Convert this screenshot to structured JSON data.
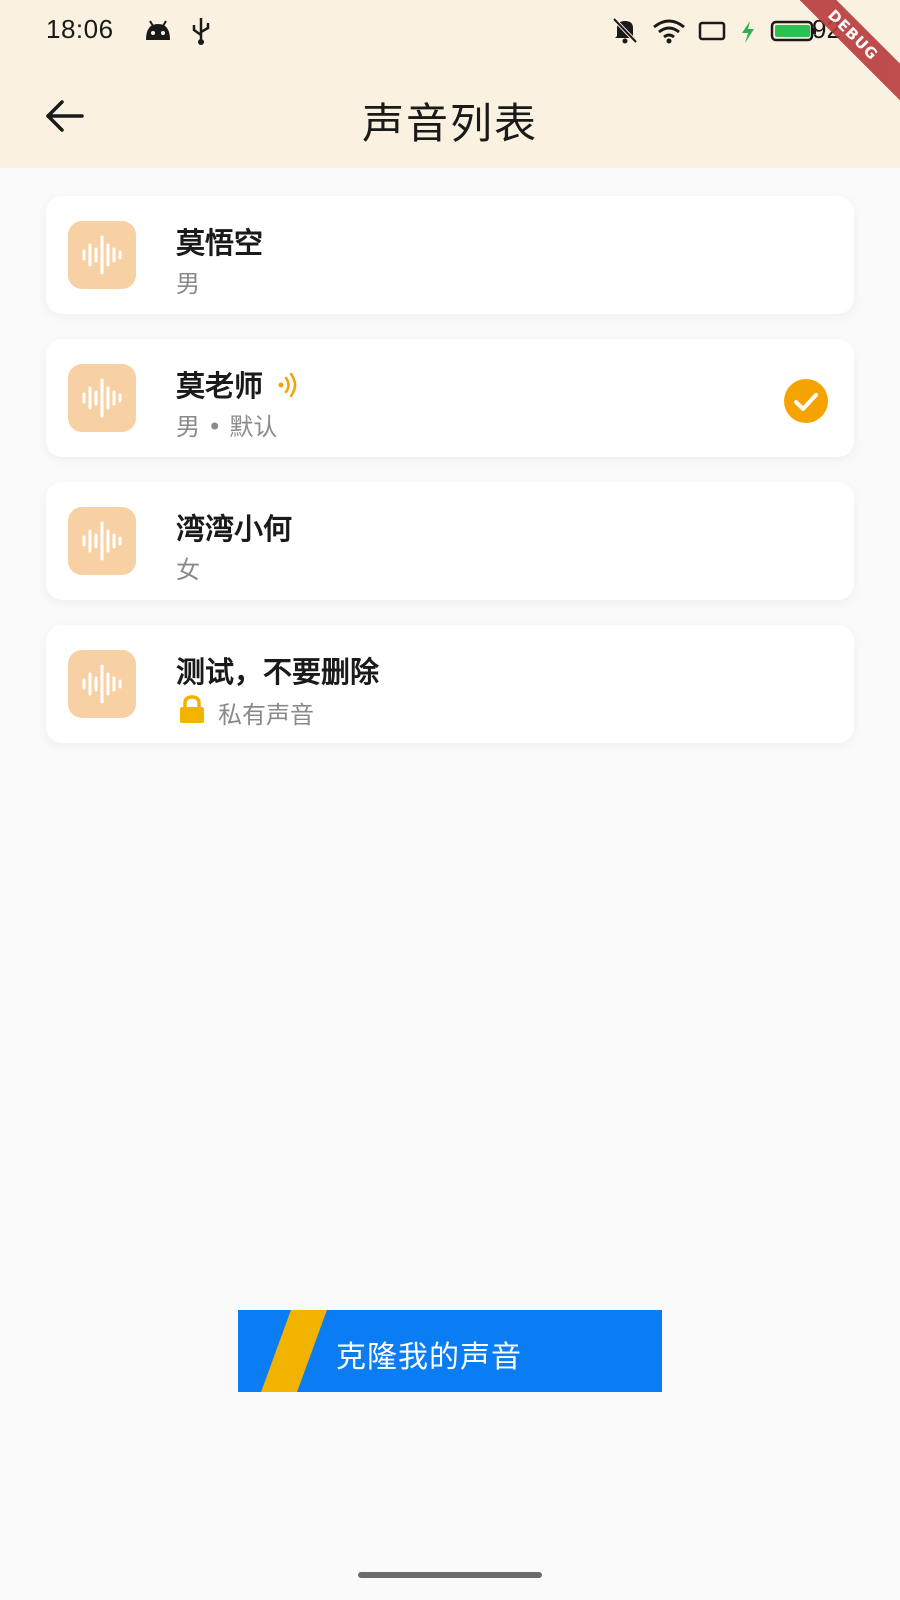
{
  "status_bar": {
    "time": "18:06",
    "battery_level": "92",
    "icons": [
      "android-icon",
      "usb-icon",
      "mute-icon",
      "wifi-icon",
      "screen-icon",
      "charging-icon",
      "battery-icon"
    ],
    "debug_banner": "DEBUG"
  },
  "header": {
    "title": "声音列表",
    "back_icon": "arrow-left-icon"
  },
  "voices": [
    {
      "name": "莫悟空",
      "subtitle": "男",
      "selected": false,
      "playing": false,
      "private": false
    },
    {
      "name": "莫老师",
      "subtitle": "男 • 默认",
      "selected": true,
      "playing": true,
      "private": false
    },
    {
      "name": "湾湾小何",
      "subtitle": "女",
      "selected": false,
      "playing": false,
      "private": false
    },
    {
      "name": "测试，不要删除",
      "subtitle": "私有声音",
      "selected": false,
      "playing": false,
      "private": true
    }
  ],
  "clone_button": {
    "label": "克隆我的声音"
  },
  "colors": {
    "header_bg": "#fbf1e1",
    "accent": "#f5a300",
    "icon_bg": "#f7d1a3",
    "button_bg": "#0a7cf4",
    "button_stripe": "#f2b300"
  }
}
